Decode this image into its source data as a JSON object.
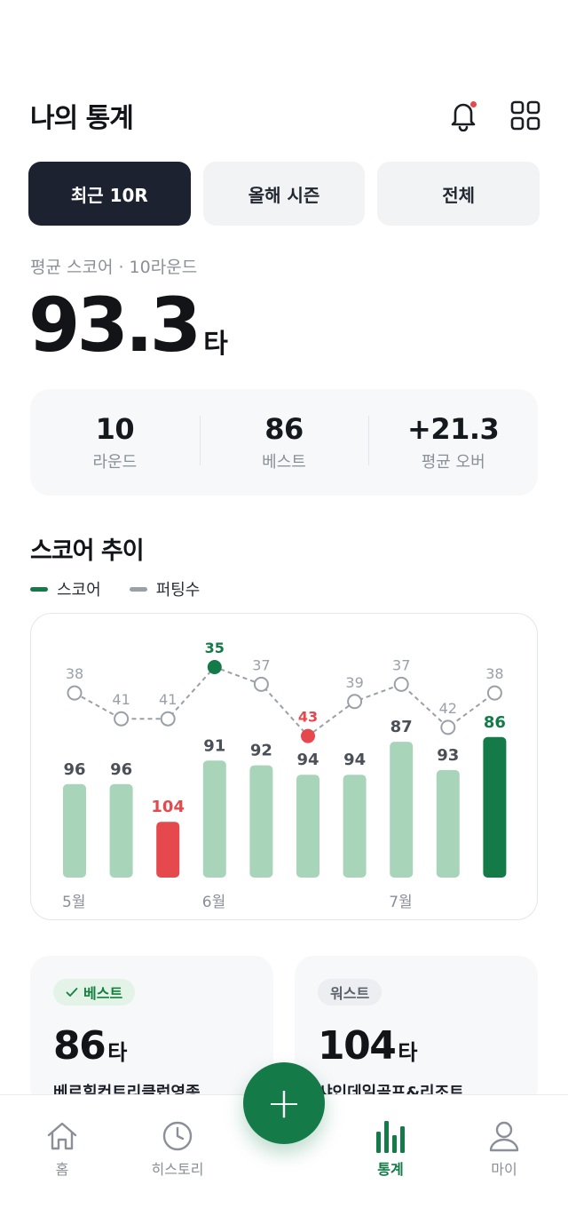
{
  "header": {
    "title": "나의 통계",
    "icons": [
      "bell-icon",
      "grid-icon"
    ]
  },
  "tabs": [
    {
      "label": "최근 10R",
      "active": true
    },
    {
      "label": "올해 시즌",
      "active": false
    },
    {
      "label": "전체",
      "active": false
    }
  ],
  "average": {
    "label": "평균 스코어 · 10라운드",
    "value": "93.3",
    "unit": "타"
  },
  "summary": [
    {
      "value": "10",
      "label": "라운드"
    },
    {
      "value": "86",
      "label": "베스트"
    },
    {
      "value": "+21.3",
      "label": "평균 오버"
    }
  ],
  "trend": {
    "title": "스코어 추이",
    "legend": [
      {
        "label": "스코어",
        "color": "#137a48"
      },
      {
        "label": "퍼팅수",
        "color": "#9aa0a8"
      }
    ]
  },
  "chart_data": {
    "type": "bar",
    "categories": [
      "",
      "",
      "",
      "",
      "",
      "",
      "",
      "",
      "",
      ""
    ],
    "month_labels": [
      {
        "index": 0,
        "label": "5월"
      },
      {
        "index": 3,
        "label": "6월"
      },
      {
        "index": 7,
        "label": "7월"
      }
    ],
    "series": [
      {
        "name": "스코어",
        "type": "bar",
        "values": [
          96,
          96,
          104,
          91,
          92,
          94,
          94,
          87,
          93,
          86
        ]
      },
      {
        "name": "퍼팅수",
        "type": "line",
        "values": [
          38,
          41,
          41,
          35,
          37,
          43,
          39,
          37,
          42,
          38
        ]
      }
    ],
    "highlight": {
      "best_index": 9,
      "worst_index": 2,
      "putt_best_index": 3,
      "putt_worst_index": 5
    },
    "colors": {
      "bar": "#a8d5b9",
      "best": "#137a48",
      "worst": "#e5484d",
      "putt": "#9aa0a8",
      "label": "#4b5058"
    }
  },
  "best": {
    "badge": "베스트",
    "score": "86",
    "unit": "타",
    "course": "베르힐컨트리클럽영종"
  },
  "worst": {
    "badge": "워스트",
    "score": "104",
    "unit": "타",
    "course": "샤인데일골프&리조트"
  },
  "nav": [
    {
      "label": "홈",
      "icon": "home-icon",
      "active": false
    },
    {
      "label": "히스토리",
      "icon": "clock-icon",
      "active": false
    },
    {
      "label": "통계",
      "icon": "bar-chart-icon",
      "active": true
    },
    {
      "label": "마이",
      "icon": "user-icon",
      "active": false
    }
  ],
  "fab": {
    "icon": "plus-icon",
    "symbol": "+"
  }
}
